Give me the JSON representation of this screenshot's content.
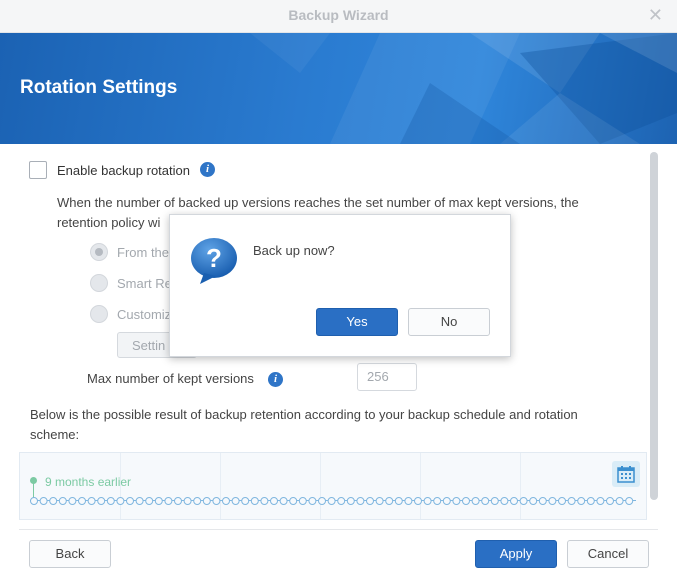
{
  "window": {
    "title": "Backup Wizard"
  },
  "banner": {
    "heading": "Rotation Settings"
  },
  "rotation": {
    "enable_label": "Enable backup rotation",
    "enabled": false,
    "description": "When the number of backed up versions reaches the set number of max kept versions, the retention policy wi",
    "options": [
      {
        "label": "From the",
        "selected": true
      },
      {
        "label": "Smart Re",
        "selected": false
      },
      {
        "label": "Customiz",
        "selected": false
      }
    ],
    "settings_button": "Settin",
    "max_versions_label": "Max number of kept versions",
    "max_versions_value": "256"
  },
  "retention": {
    "description": "Below is the possible result of backup retention according to your backup schedule and rotation scheme:",
    "timeline_label": "9 months earlier"
  },
  "footer": {
    "back": "Back",
    "apply": "Apply",
    "cancel": "Cancel"
  },
  "dialog": {
    "message": "Back up now?",
    "yes": "Yes",
    "no": "No"
  },
  "colors": {
    "accent": "#2a6fc4",
    "banner": "#2a7bd0",
    "timeline_green": "#7ccaa3",
    "timeline_blue": "#7fb6df"
  },
  "icons": {
    "close": "close-icon",
    "info": "info-icon",
    "calendar": "calendar-icon",
    "question": "question-bubble-icon"
  }
}
